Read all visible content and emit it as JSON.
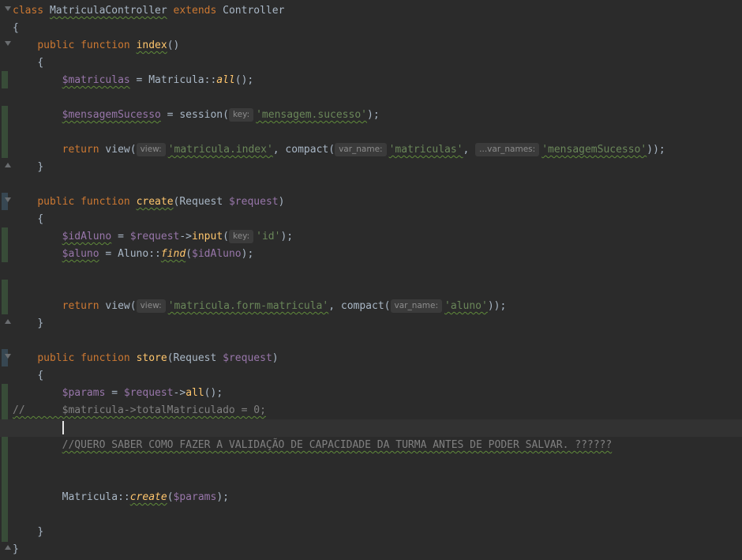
{
  "code": {
    "class_kw": "class",
    "class_name": "MatriculaController",
    "extends_kw": "extends",
    "parent_class": "Controller",
    "brace_open": "{",
    "brace_close": "}",
    "public_kw": "public",
    "function_kw": "function",
    "return_kw": "return",
    "methods": {
      "index": {
        "name": "index",
        "params": "()",
        "line1": {
          "var": "$matriculas",
          "rest": " = Matricula::",
          "call": "all",
          "end": "();"
        },
        "line2": {
          "var": "$mensagemSucesso",
          "rest": " = session(",
          "hint": "key:",
          "str": "'mensagem.sucesso'",
          "end": ");"
        },
        "line3": {
          "call": " view(",
          "hint1": "view:",
          "str1": "'matricula.index'",
          "mid": ", compact(",
          "hint2": "var_name:",
          "str2": "'matriculas'",
          "sep": ", ",
          "hint3": "...var_names:",
          "str3": "'mensagemSucesso'",
          "end": "));"
        }
      },
      "create": {
        "name": "create",
        "params_open": "(Request ",
        "param_var": "$request",
        "params_close": ")",
        "line1": {
          "var": "$idAluno",
          "eq": " = ",
          "obj": "$request",
          "arrow": "->",
          "call": "input",
          "paren": "(",
          "hint": "key:",
          "str": "'id'",
          "end": ");"
        },
        "line2": {
          "var": "$aluno",
          "rest": " = Aluno::",
          "call": "find",
          "paren": "(",
          "arg": "$idAluno",
          "end": ");"
        },
        "line3": {
          "call": " view(",
          "hint1": "view:",
          "str1": "'matricula.form-matricula'",
          "mid": ", compact(",
          "hint2": "var_name:",
          "str2": "'aluno'",
          "end": "));"
        }
      },
      "store": {
        "name": "store",
        "params_open": "(Request ",
        "param_var": "$request",
        "params_close": ")",
        "line1": {
          "var": "$params",
          "eq": " = ",
          "obj": "$request",
          "arrow": "->",
          "call": "all",
          "end": "();"
        },
        "commented_line": "//      $matricula->totalMatriculado = 0;",
        "comment_note": "//QUERO SABER COMO FAZER A VALIDAÇÃO DE CAPACIDADE DA TURMA ANTES DE PODER SALVAR. ??????",
        "line_create": {
          "cls": "Matricula::",
          "call": "create",
          "paren": "(",
          "arg": "$params",
          "end": ");"
        }
      }
    }
  }
}
